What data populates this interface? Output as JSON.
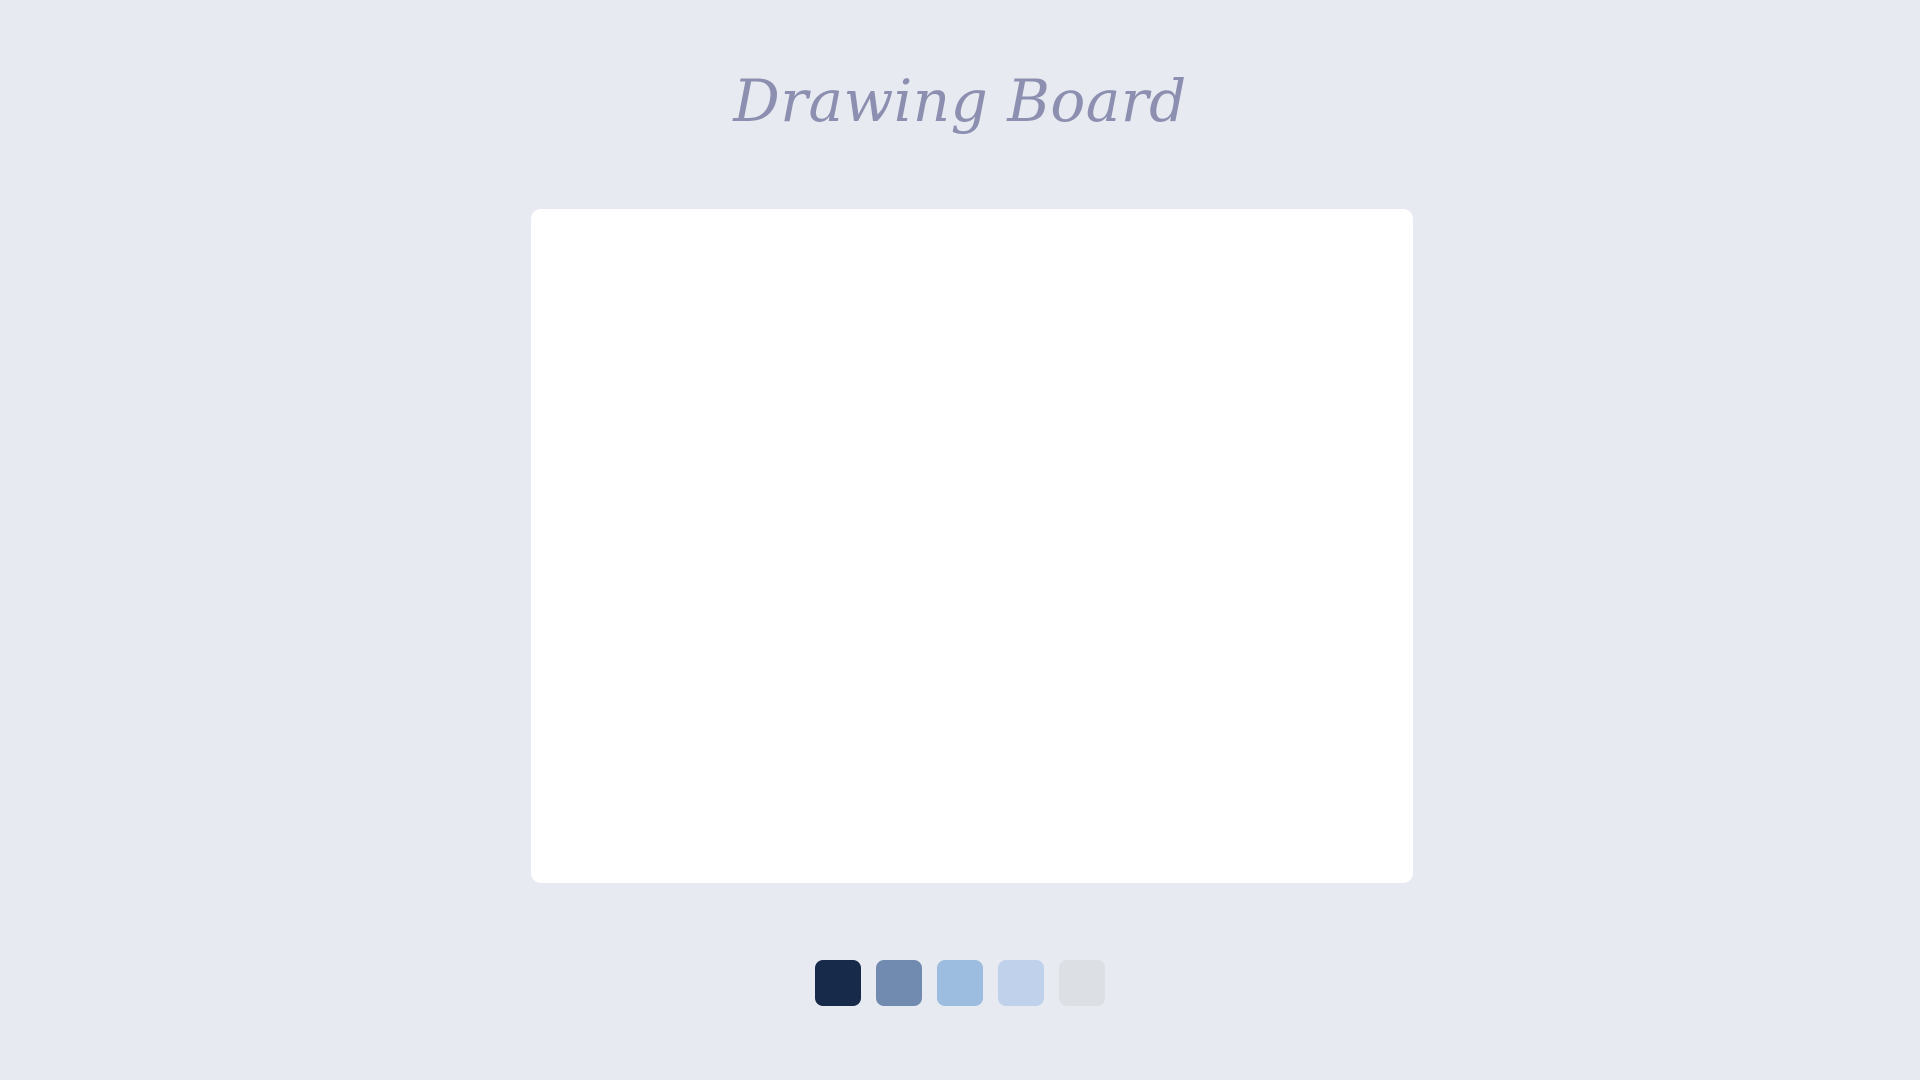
{
  "app": {
    "title": "Drawing Board"
  },
  "palette": {
    "colors": [
      {
        "name": "navy",
        "hex": "#172a4a"
      },
      {
        "name": "slate-blue",
        "hex": "#718bb0"
      },
      {
        "name": "sky-blue",
        "hex": "#9dbde0"
      },
      {
        "name": "pale-blue",
        "hex": "#c0d1eb"
      },
      {
        "name": "light-gray",
        "hex": "#dcdfe4"
      }
    ]
  }
}
